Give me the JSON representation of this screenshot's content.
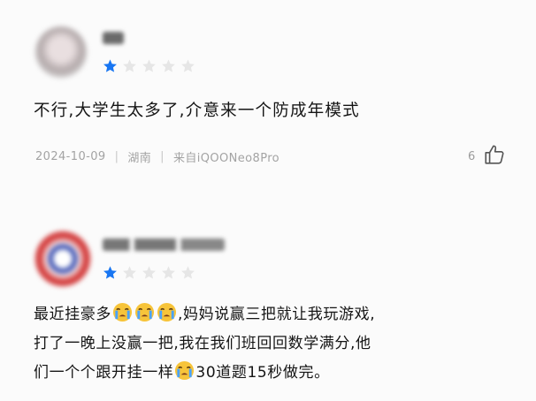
{
  "reviews": [
    {
      "username": "■■",
      "rating": 1,
      "max_rating": 5,
      "text": "不行,大学生太多了,介意来一个防成年模式",
      "date": "2024-10-09",
      "location": "湖南",
      "device": "来自iQOONeo8Pro",
      "likes": "6"
    },
    {
      "username": "■■■■■■",
      "rating": 1,
      "max_rating": 5,
      "line1_a": "最近挂豪多",
      "line1_b": ",妈妈说赢三把就让我玩游戏,",
      "line2": "打了一晚上没赢一把,我在我们班回回数学满分,他",
      "line3_a": "们一个个跟开挂一样",
      "line3_b": "30道题15秒做完。"
    }
  ],
  "colors": {
    "star_active": "#1876f2",
    "star_inactive": "#e6e6e6",
    "meta_text": "#a3a3a3"
  },
  "icons": [
    "thumbs-up-icon",
    "star-icon",
    "crying-emoji-icon"
  ]
}
